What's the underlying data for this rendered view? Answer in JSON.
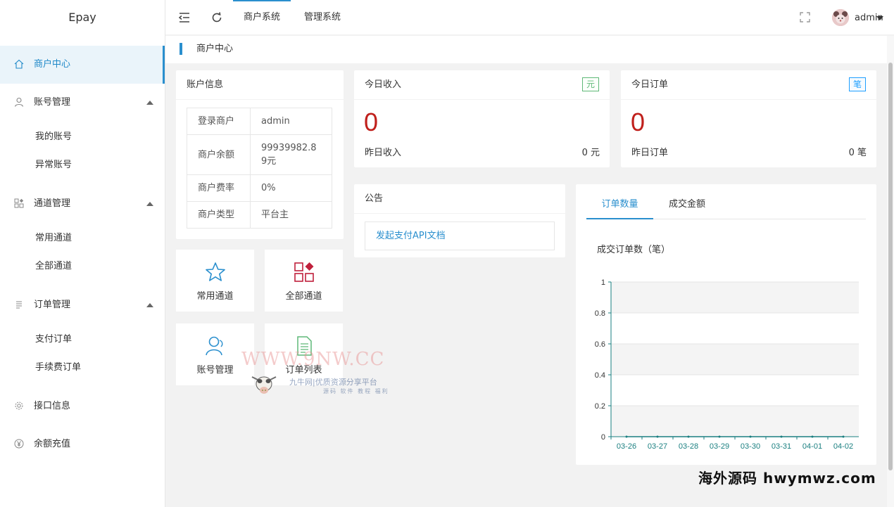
{
  "app": {
    "logo": "Epay"
  },
  "sidebar": {
    "items": [
      {
        "label": "商户中心",
        "icon": "home-icon",
        "active": true
      },
      {
        "label": "账号管理",
        "icon": "user-icon",
        "children": [
          "我的账号",
          "异常账号"
        ]
      },
      {
        "label": "通道管理",
        "icon": "apps-icon",
        "children": [
          "常用通道",
          "全部通道"
        ]
      },
      {
        "label": "订单管理",
        "icon": "list-icon",
        "children": [
          "支付订单",
          "手续费订单"
        ]
      },
      {
        "label": "接口信息",
        "icon": "gear-icon"
      },
      {
        "label": "余额充值",
        "icon": "yen-icon"
      }
    ]
  },
  "header": {
    "tabs": [
      "商户系统",
      "管理系统"
    ],
    "user": "admin"
  },
  "breadcrumb": "商户中心",
  "account": {
    "title": "账户信息",
    "rows": [
      {
        "k": "登录商户",
        "v": "admin"
      },
      {
        "k": "商户余额",
        "v": "99939982.89元"
      },
      {
        "k": "商户费率",
        "v": "0%"
      },
      {
        "k": "商户类型",
        "v": "平台主"
      }
    ]
  },
  "income": {
    "title": "今日收入",
    "badge": "元",
    "value": "0",
    "sub_label": "昨日收入",
    "sub_value": "0 元"
  },
  "orders": {
    "title": "今日订单",
    "badge": "笔",
    "value": "0",
    "sub_label": "昨日订单",
    "sub_value": "0 笔"
  },
  "quick": [
    "常用通道",
    "全部通道",
    "账号管理",
    "订单列表"
  ],
  "notice": {
    "title": "公告",
    "link": "发起支付API文档"
  },
  "chart_tabs": [
    "订单数量",
    "成交金额"
  ],
  "chart_data": {
    "type": "line",
    "title": "成交订单数（笔）",
    "categories": [
      "03-26",
      "03-27",
      "03-28",
      "03-29",
      "03-30",
      "03-31",
      "04-01",
      "04-02"
    ],
    "values": [
      0,
      0,
      0,
      0,
      0,
      0,
      0,
      0
    ],
    "yticks": [
      "0",
      "0.2",
      "0.4",
      "0.6",
      "0.8",
      "1"
    ],
    "ylim": [
      0,
      1
    ],
    "grid": true
  },
  "watermark": {
    "site": "WWW.9NW.CC",
    "brand": "九牛网|优质资源分享平台",
    "tags": "源码 软件 教程 福利",
    "footer": "海外源码 hwymwz.com"
  },
  "colors": {
    "accent": "#2a8fce",
    "danger": "#c0201c",
    "badge_green": "#5fb878",
    "badge_blue": "#1e9fff"
  }
}
